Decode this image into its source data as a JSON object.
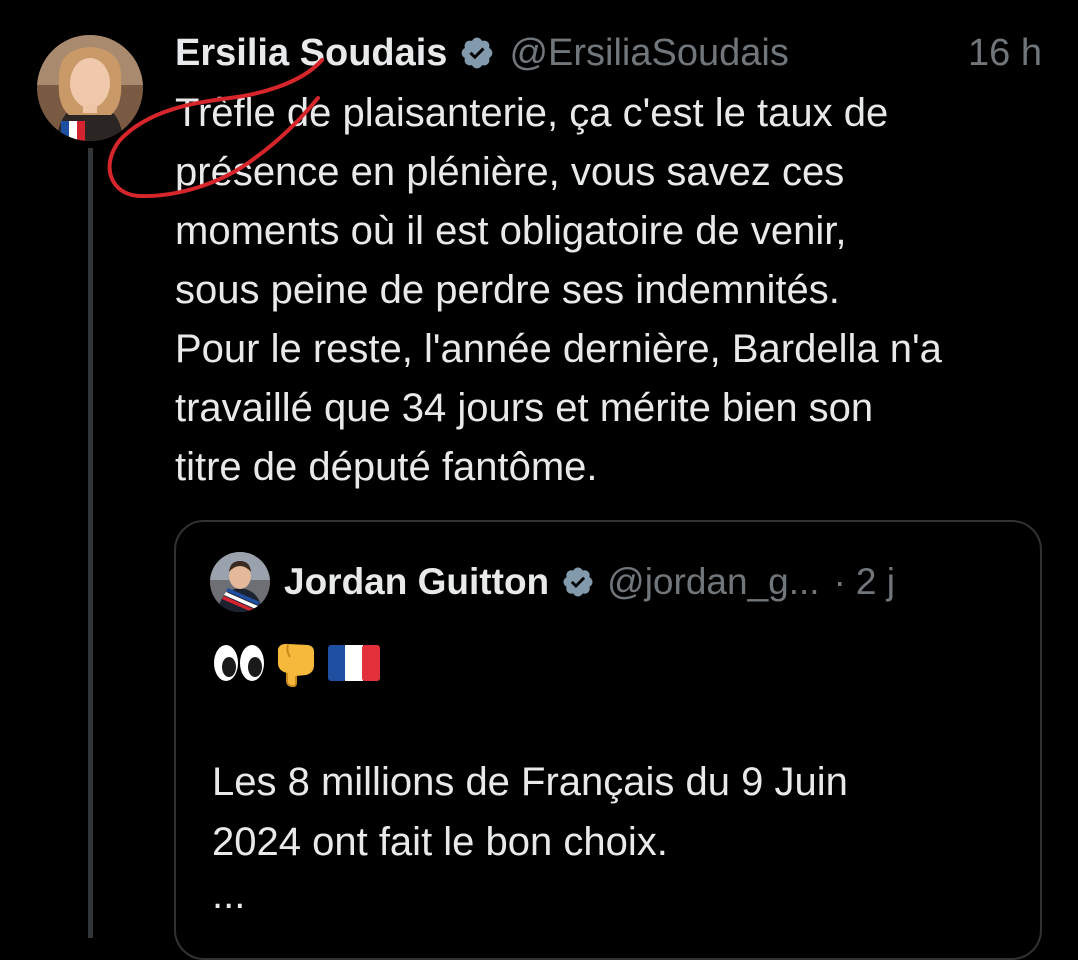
{
  "tweet": {
    "author_name": "Ersilia Soudais",
    "handle": "@ErsiliaSoudais",
    "time": "16 h",
    "text": "Trèfle de plaisanterie, ça c'est le taux de\nprésence en plénière, vous savez ces\nmoments où il est obligatoire de venir,\nsous peine de perdre ses indemnités.\nPour le reste, l'année dernière, Bardella n'a\ntravaillé que 34 jours et mérite bien son\ntitre de député fantôme."
  },
  "quoted_tweet": {
    "author_name": "Jordan Guitton",
    "handle": "@jordan_g...",
    "separator": "·",
    "time": "2 j",
    "emojis": [
      "eyes-emoji",
      "pointing-down-emoji",
      "france-flag-emoji"
    ],
    "text": "Les 8 millions de Français du 9 Juin\n2024 ont fait le bon choix.",
    "ellipsis": "..."
  },
  "colors": {
    "background": "#000000",
    "text_primary": "#e7e9ea",
    "text_secondary": "#71767b",
    "verified_badge": "#829aab",
    "scribble": "#d6262b",
    "border": "#2f3336"
  }
}
